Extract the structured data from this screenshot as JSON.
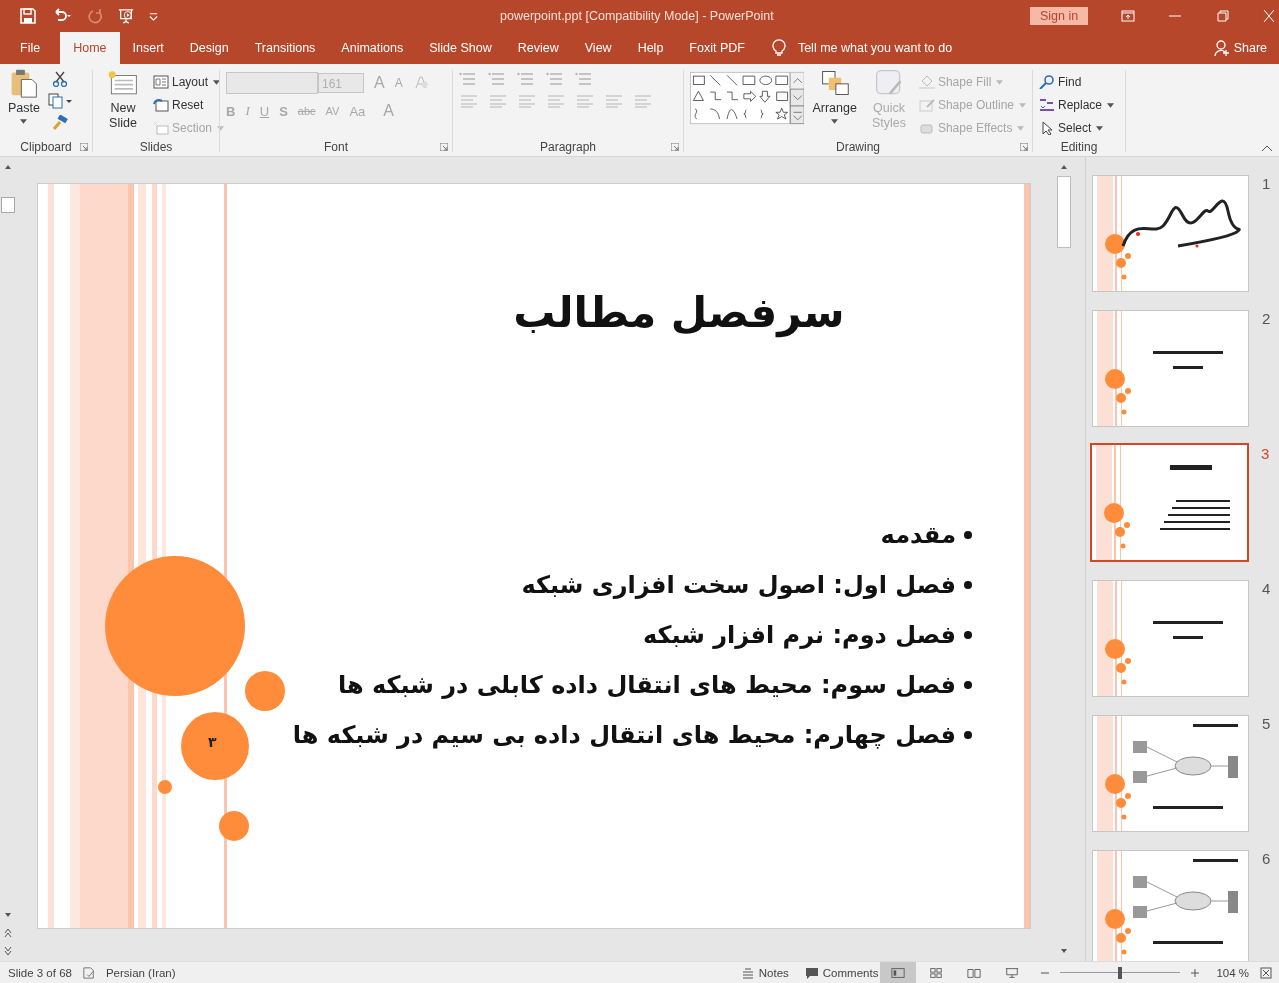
{
  "window": {
    "title": "powerpoint.ppt [Compatibility Mode]  -  PowerPoint",
    "sign_in": "Sign in"
  },
  "tabs": [
    {
      "label": "File",
      "selected": false
    },
    {
      "label": "Home",
      "selected": true
    },
    {
      "label": "Insert",
      "selected": false
    },
    {
      "label": "Design",
      "selected": false
    },
    {
      "label": "Transitions",
      "selected": false
    },
    {
      "label": "Animations",
      "selected": false
    },
    {
      "label": "Slide Show",
      "selected": false
    },
    {
      "label": "Review",
      "selected": false
    },
    {
      "label": "View",
      "selected": false
    },
    {
      "label": "Help",
      "selected": false
    },
    {
      "label": "Foxit PDF",
      "selected": false
    }
  ],
  "tell_me": "Tell me what you want to do",
  "share": "Share",
  "ribbon": {
    "clipboard": {
      "label": "Clipboard",
      "paste": "Paste"
    },
    "slides": {
      "label": "Slides",
      "new_slide": "New Slide",
      "items": [
        {
          "kind": "layout",
          "label": "Layout",
          "disabled": false
        },
        {
          "kind": "reset",
          "label": "Reset",
          "disabled": false
        },
        {
          "kind": "section",
          "label": "Section",
          "disabled": true
        }
      ]
    },
    "font": {
      "label": "Font",
      "size": "161",
      "disabled": true,
      "grow": "A",
      "shrink": "A",
      "buttons": [
        "B",
        "I",
        "U",
        "S",
        "abc",
        "AV",
        "Aa",
        "A"
      ]
    },
    "paragraph": {
      "label": "Paragraph",
      "disabled": true
    },
    "drawing": {
      "label": "Drawing",
      "arrange": "Arrange",
      "quick_styles": "Quick Styles",
      "quick_styles_disabled": true,
      "format": [
        {
          "kind": "fill",
          "label": "Shape Fill",
          "disabled": true
        },
        {
          "kind": "outline",
          "label": "Shape Outline",
          "disabled": true
        },
        {
          "kind": "effects",
          "label": "Shape Effects",
          "disabled": true
        }
      ]
    },
    "editing": {
      "label": "Editing",
      "items": [
        {
          "kind": "find",
          "label": "Find"
        },
        {
          "kind": "replace",
          "label": "Replace"
        },
        {
          "kind": "select",
          "label": "Select"
        }
      ]
    }
  },
  "slide": {
    "title": "سرفصل مطالب",
    "bullets": [
      "مقدمه",
      "فصل اول: اصول سخت افزاری شبکه",
      "فصل دوم: نرم افزار شبکه",
      "فصل سوم: محیط های انتقال داده کابلی در شبکه ها",
      "فصل چهارم: محیط های انتقال داده بی سیم در شبکه ها"
    ],
    "page_number": "٣"
  },
  "thumbnails": [
    {
      "number": "1",
      "kind": "calligraphy",
      "selected": false
    },
    {
      "number": "2",
      "kind": "text",
      "selected": false
    },
    {
      "number": "3",
      "kind": "list",
      "selected": true
    },
    {
      "number": "4",
      "kind": "text",
      "selected": false
    },
    {
      "number": "5",
      "kind": "diagram",
      "selected": false
    },
    {
      "number": "6",
      "kind": "diagram",
      "selected": false
    }
  ],
  "status_bar": {
    "slide": "Slide 3 of 68",
    "language": "Persian (Iran)",
    "notes": "Notes",
    "comments": "Comments",
    "views": [
      {
        "kind": "normal",
        "selected": true
      },
      {
        "kind": "sorter",
        "selected": false
      },
      {
        "kind": "reading",
        "selected": false
      },
      {
        "kind": "slideshow",
        "selected": false
      }
    ],
    "zoom": "104 %",
    "zoom_slider": {
      "level": 0.5
    }
  }
}
